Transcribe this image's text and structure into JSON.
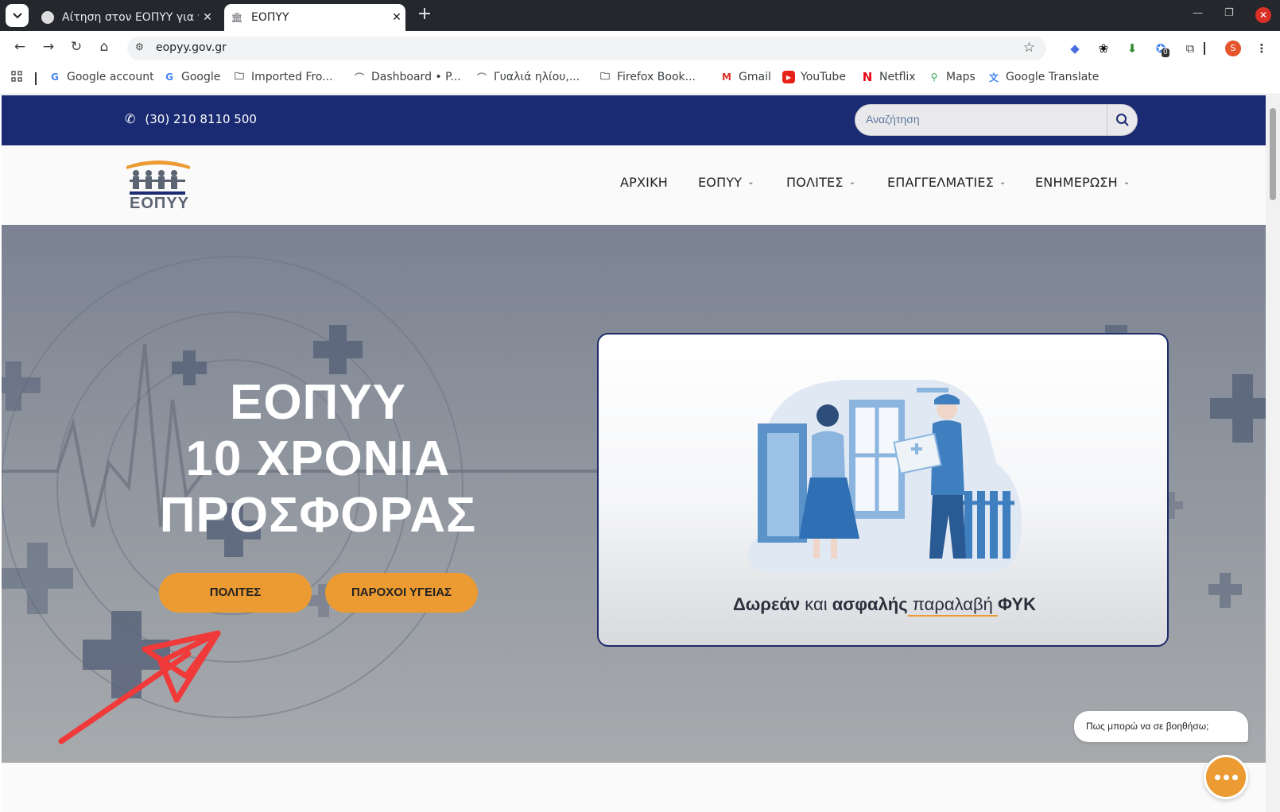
{
  "browser": {
    "tabs": [
      {
        "title": "Αίτηση στον ΕΟΠΥΥ για ν",
        "active": false
      },
      {
        "title": "ΕΟΠΥΥ",
        "active": true
      }
    ],
    "url": "eopyy.gov.gr",
    "bookmarks": [
      {
        "label": "Google account",
        "icon": "google-icon"
      },
      {
        "label": "Google",
        "icon": "google-icon"
      },
      {
        "label": "Imported Fro...",
        "icon": "folder-icon"
      },
      {
        "label": "Dashboard • P...",
        "icon": "site-icon"
      },
      {
        "label": "Γυαλιά ηλίου,...",
        "icon": "site-icon"
      },
      {
        "label": "Firefox Book...",
        "icon": "folder-icon"
      },
      {
        "label": "Gmail",
        "icon": "gmail-icon"
      },
      {
        "label": "YouTube",
        "icon": "youtube-icon"
      },
      {
        "label": "Netflix",
        "icon": "netflix-icon"
      },
      {
        "label": "Maps",
        "icon": "maps-icon"
      },
      {
        "label": "Google Translate",
        "icon": "translate-icon"
      }
    ],
    "extension_badge": "0",
    "profile_initial": "S"
  },
  "site": {
    "phone": "(30) 210 8110 500",
    "search_placeholder": "Αναζήτηση",
    "logo_text": "ΕΟΠΥΥ",
    "nav": [
      {
        "label": "ΑΡΧΙΚΗ",
        "dropdown": false
      },
      {
        "label": "ΕΟΠΥΥ",
        "dropdown": true
      },
      {
        "label": "ΠΟΛΙΤΕΣ",
        "dropdown": true
      },
      {
        "label": "ΕΠΑΓΓΕΛΜΑΤΙΕΣ",
        "dropdown": true
      },
      {
        "label": "ΕΝΗΜΕΡΩΣΗ",
        "dropdown": true
      }
    ],
    "hero": {
      "title_line1": "ΕΟΠΥΥ",
      "title_line2": "10 ΧΡΟΝΙΑ",
      "title_line3": "ΠΡΟΣΦΟΡΑΣ",
      "button_citizens": "ΠΟΛΙΤΕΣ",
      "button_providers": "ΠΑΡΟΧΟΙ ΥΓΕΙΑΣ"
    },
    "card": {
      "caption_bold1": "Δωρεάν",
      "caption_light1": " και ",
      "caption_bold2": "ασφαλής",
      "caption_light2": " παραλαβή ",
      "caption_bold3": "ΦΥΚ"
    },
    "chat": {
      "prompt": "Πως μπορώ να σε βοηθήσω;"
    }
  },
  "colors": {
    "topbar": "#1a2b73",
    "accent_orange": "#ec9b33",
    "arrow_red": "#f03a3a"
  }
}
